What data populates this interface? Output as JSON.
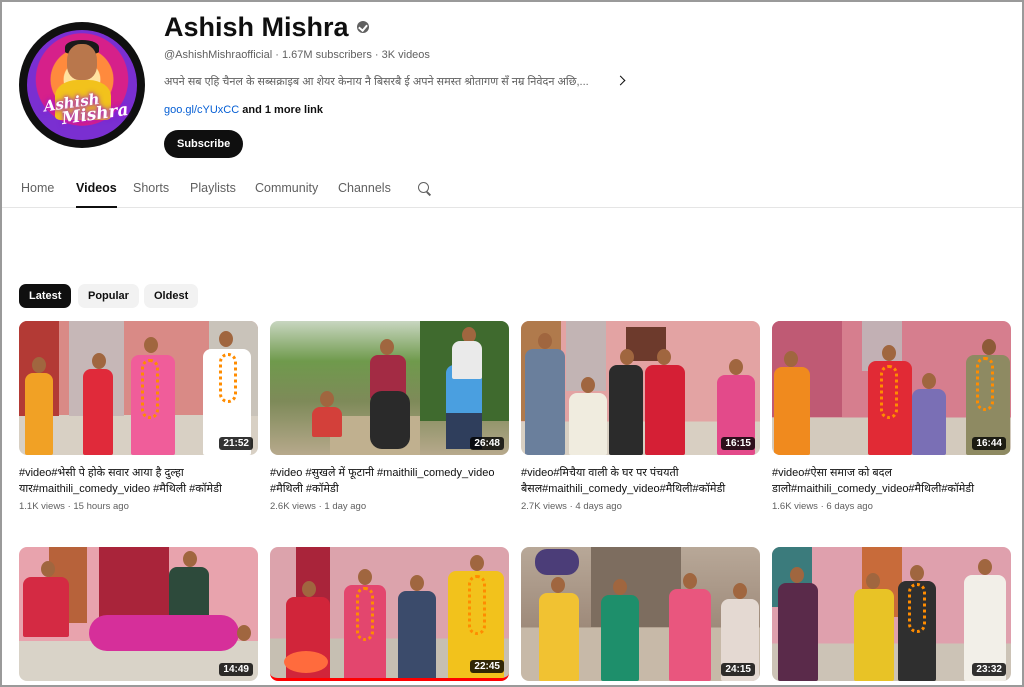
{
  "channel": {
    "name": "Ashish Mishra",
    "handle": "@AshishMishraofficial",
    "subscribers": "1.67M subscribers",
    "videos_count": "3K videos",
    "description": "अपने सब एहि चैनल के सब्सक्राइब आ शेयर केनाय नै बिसरबै ई अपने समस्त श्रोतागण सँ नम्र निवेदन अछि,...",
    "link": "goo.gl/cYUxCC",
    "more_links": "and 1 more link",
    "subscribe_label": "Subscribe",
    "avatar_logo_text": [
      "Ashish",
      "Mishra"
    ]
  },
  "tabs": [
    "Home",
    "Videos",
    "Shorts",
    "Playlists",
    "Community",
    "Channels"
  ],
  "active_tab": "Videos",
  "chips": [
    "Latest",
    "Popular",
    "Oldest"
  ],
  "active_chip": "Latest",
  "videos": [
    {
      "title": "#video#भेसी पे होके सवार आया है दुल्हा यार#maithili_comedy_video #मैथिली #कॉमेडी",
      "views": "1.1K views",
      "age": "15 hours ago",
      "duration": "21:52"
    },
    {
      "title": "#video #सुखले में फूटानी #maithili_comedy_video #मैथिली #कॉमेडी",
      "views": "2.6K views",
      "age": "1 day ago",
      "duration": "26:48"
    },
    {
      "title": "#video#मिचैया वाली के घर पर पंचयती बैसल#maithili_comedy_video#मैथिली#कॉमेडी",
      "views": "2.7K views",
      "age": "4 days ago",
      "duration": "16:15"
    },
    {
      "title": "#video#ऐसा समाज को बदल डालो#maithili_comedy_video#मैथिली#कॉमेडी",
      "views": "1.6K views",
      "age": "6 days ago",
      "duration": "16:44"
    },
    {
      "title": "",
      "views": "",
      "age": "",
      "duration": "14:49"
    },
    {
      "title": "",
      "views": "",
      "age": "",
      "duration": "22:45"
    },
    {
      "title": "",
      "views": "",
      "age": "",
      "duration": "24:15"
    },
    {
      "title": "",
      "views": "",
      "age": "",
      "duration": "23:32"
    }
  ],
  "colors": {
    "text_primary": "#0f0f0f",
    "text_secondary": "#606060",
    "link": "#065fd4",
    "chip_bg": "#f2f2f2"
  }
}
